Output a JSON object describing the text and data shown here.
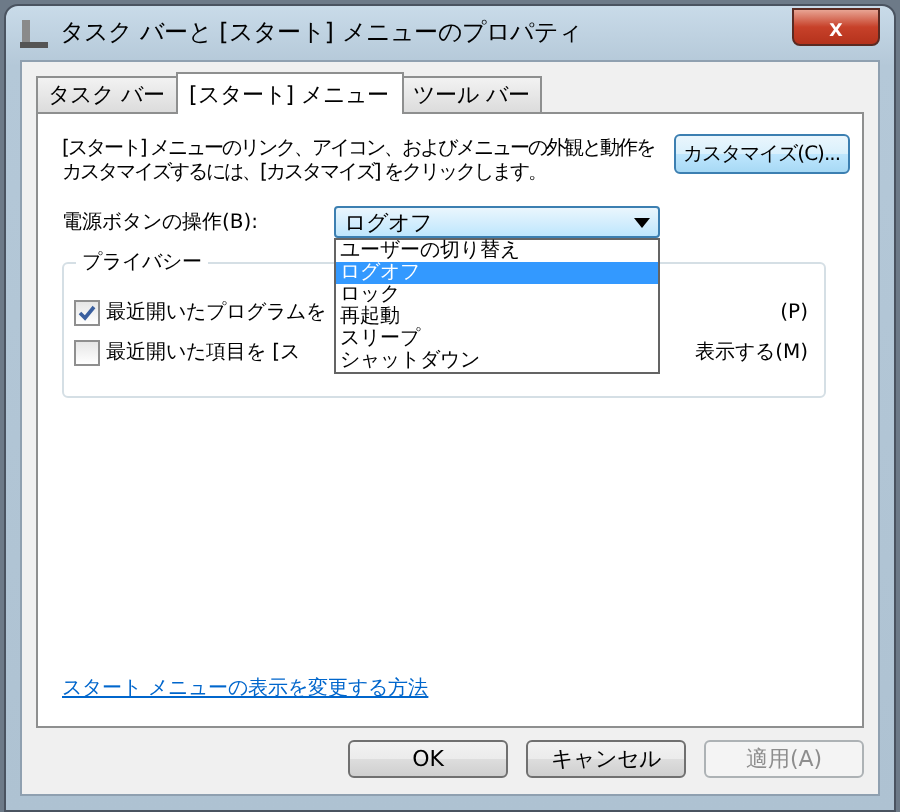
{
  "window": {
    "title": "タスク バーと [スタート] メニューのプロパティ",
    "close": "x"
  },
  "tabs": [
    {
      "label": "タスク バー",
      "selected": false
    },
    {
      "label": "[スタート] メニュー",
      "selected": true
    },
    {
      "label": "ツール バー",
      "selected": false
    }
  ],
  "description": [
    "[スタート] メニューのリンク、アイコン、およびメニューの外観と動作を",
    "カスタマイズするには、[カスタマイズ] をクリックします。"
  ],
  "customize_button": "カスタマイズ(C)...",
  "power_button": {
    "label": "電源ボタンの操作(B):",
    "value": "ログオフ",
    "expanded": true,
    "options": [
      {
        "label": "ユーザーの切り替え",
        "selected": false
      },
      {
        "label": "ログオフ",
        "selected": true
      },
      {
        "label": "ロック",
        "selected": false
      },
      {
        "label": "再起動",
        "selected": false
      },
      {
        "label": "スリープ",
        "selected": false
      },
      {
        "label": "シャットダウン",
        "selected": false
      }
    ]
  },
  "privacy": {
    "title": "プライバシー",
    "checkboxes": [
      {
        "label_left": "最近開いたプログラムを",
        "label_right": "(P)",
        "checked": true
      },
      {
        "label_left": "最近開いた項目を [ス",
        "label_right": "表示する(M)",
        "checked": false
      }
    ]
  },
  "help_link": "スタート メニューの表示を変更する方法",
  "buttons": [
    {
      "label": "OK",
      "disabled": false
    },
    {
      "label": "キャンセル",
      "disabled": false
    },
    {
      "label": "適用(A)",
      "disabled": true
    }
  ]
}
